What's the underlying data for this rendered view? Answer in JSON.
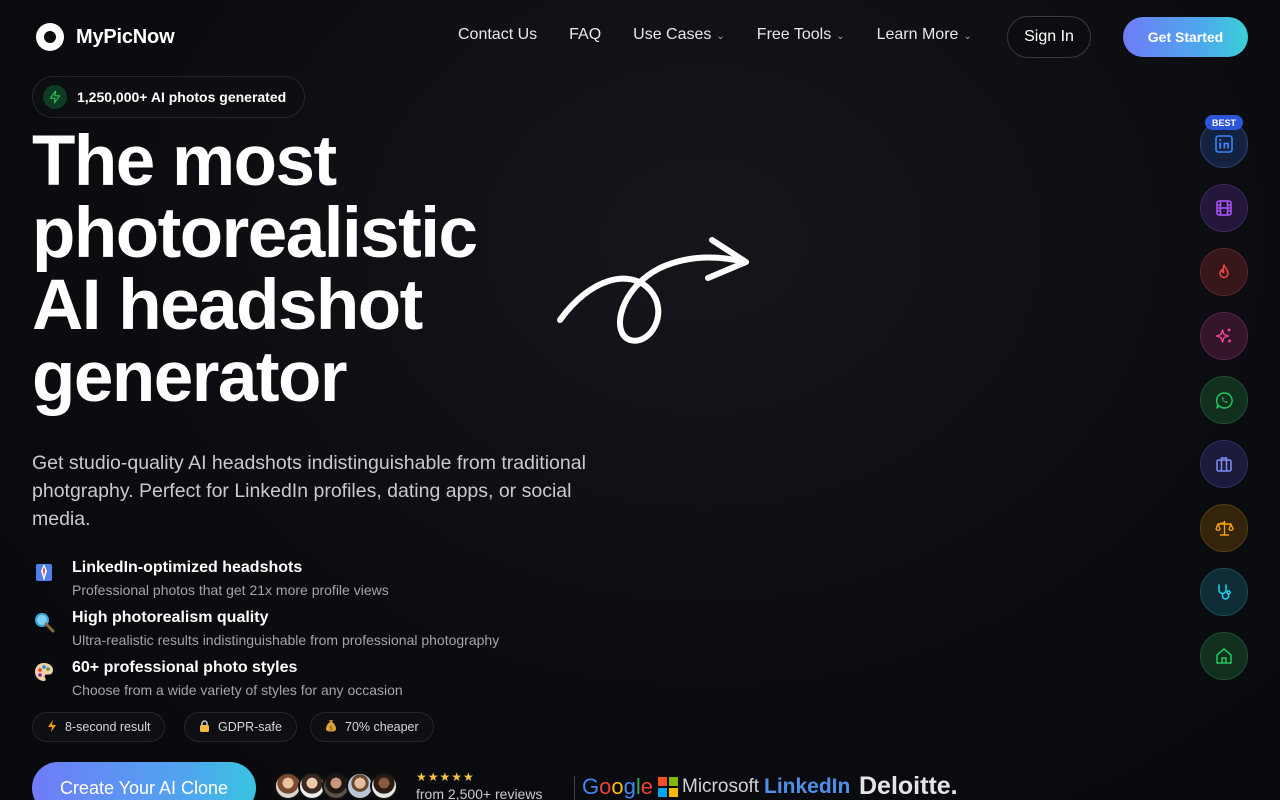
{
  "header": {
    "brand": "MyPicNow",
    "nav": [
      {
        "label": "Contact Us",
        "dropdown": false
      },
      {
        "label": "FAQ",
        "dropdown": false
      },
      {
        "label": "Use Cases",
        "dropdown": true
      },
      {
        "label": "Free Tools",
        "dropdown": true
      },
      {
        "label": "Learn More",
        "dropdown": true
      }
    ],
    "sign_in": "Sign In",
    "get_started": "Get Started"
  },
  "hero": {
    "counter": "1,250,000+ AI photos generated",
    "headline_lines": [
      "The most",
      "photorealistic",
      "AI headshot",
      "generator"
    ],
    "subtitle": "Get studio-quality AI headshots indistinguishable from traditional photgraphy. Perfect for LinkedIn profiles, dating apps, or social media.",
    "features": [
      {
        "icon": "suit-icon",
        "title": "LinkedIn-optimized headshots",
        "desc": "Professional photos that get 21x more profile views"
      },
      {
        "icon": "magnifier-icon",
        "title": "High photorealism quality",
        "desc": "Ultra-realistic results indistinguishable from professional photography"
      },
      {
        "icon": "palette-icon",
        "title": "60+ professional photo styles",
        "desc": "Choose from a wide variety of styles for any occasion"
      }
    ],
    "pills": [
      {
        "icon": "bolt-icon",
        "label": "8-second result"
      },
      {
        "icon": "lock-icon",
        "label": "GDPR-safe"
      },
      {
        "icon": "money-bag-icon",
        "label": "70% cheaper"
      }
    ],
    "cta": "Create Your AI Clone",
    "rating_stars": "★★★★★",
    "reviews": "from 2,500+ reviews",
    "brands": [
      "Google",
      "Microsoft",
      "LinkedIn",
      "Deloitte."
    ]
  },
  "rail": {
    "best_badge": "BEST",
    "items": [
      {
        "icon": "linkedin-icon",
        "color": "#3b82f6",
        "bg": "#14223f"
      },
      {
        "icon": "film-icon",
        "color": "#a855f7",
        "bg": "#24173a"
      },
      {
        "icon": "flame-icon",
        "color": "#ef4444",
        "bg": "#351619"
      },
      {
        "icon": "sparkles-icon",
        "color": "#ec4899",
        "bg": "#33162a"
      },
      {
        "icon": "whatsapp-icon",
        "color": "#22c55e",
        "bg": "#10301d"
      },
      {
        "icon": "briefcase-icon",
        "color": "#818cf8",
        "bg": "#1b1c3b"
      },
      {
        "icon": "scale-icon",
        "color": "#f59e0b",
        "bg": "#33240b"
      },
      {
        "icon": "stethoscope-icon",
        "color": "#22d3ee",
        "bg": "#0f2d36"
      },
      {
        "icon": "home-icon",
        "color": "#22c55e",
        "bg": "#10301d"
      }
    ]
  }
}
